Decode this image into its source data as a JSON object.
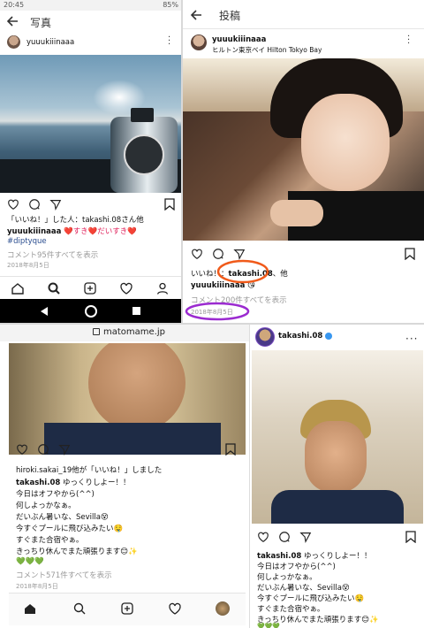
{
  "panel1": {
    "status_time": "20:45",
    "status_right": "85%",
    "title": "写真",
    "username": "yuuukiiinaaa",
    "likes_line": "「いいね！」した人：takashi.08さん他",
    "caption_user": "yuuukiiinaaa",
    "caption_text": "❤️すき❤️だいすき❤️",
    "hashtag": "#diptyque",
    "comments": "コメント95件すべてを表示",
    "date": "2018年8月5日"
  },
  "panel2": {
    "title": "投稿",
    "username": "yuuukiiinaaa",
    "location": "ヒルトン東京ベイ Hilton Tokyo Bay",
    "likes_prefix": "いいね！：",
    "likes_user": "takashi.08",
    "likes_suffix": "、他",
    "caption_user": "yuuukiiinaaa",
    "caption_emoji": "😘",
    "comments": "コメント200件すべてを表示",
    "date": "2018年8月5日"
  },
  "panel3": {
    "url": "matomame.jp",
    "likes_line": "hiroki.sakai_19他が「いいね！」しました",
    "caption_user": "takashi.08",
    "caption_lines": [
      "今日はオフやから(^^)",
      "何しよっかなぁ。",
      "だいぶん暑いな、Sevilla😵",
      "今すぐプールに飛び込みたい🤤",
      "すぐまた合宿やぁ。",
      "きっちり休んでまた頑張ります😊✨",
      "💚💚💚"
    ],
    "caption_first": "ゆっくりしよー！！",
    "comments": "コメント571件すべてを表示",
    "date": "2018年8月5日"
  },
  "panel4": {
    "username": "takashi.08",
    "caption_user": "takashi.08",
    "caption_first": "ゆっくりしよー！！",
    "caption_lines": [
      "今日はオフやから(^^)",
      "何しよっかなぁ。",
      "だいぶん暑いな、Sevilla😵",
      "今すぐプールに飛び込みたい🤤",
      "すぐまた合宿やぁ。",
      "きっちり休んでまた頑張ります😊✨",
      "💚💚💚"
    ]
  },
  "colors": {
    "heart_red": "#e0245e",
    "verified_blue": "#3897f0",
    "annotation_orange": "#f05a1a",
    "annotation_purple": "#9b2bd0",
    "link_blue": "#2a4d8f"
  }
}
